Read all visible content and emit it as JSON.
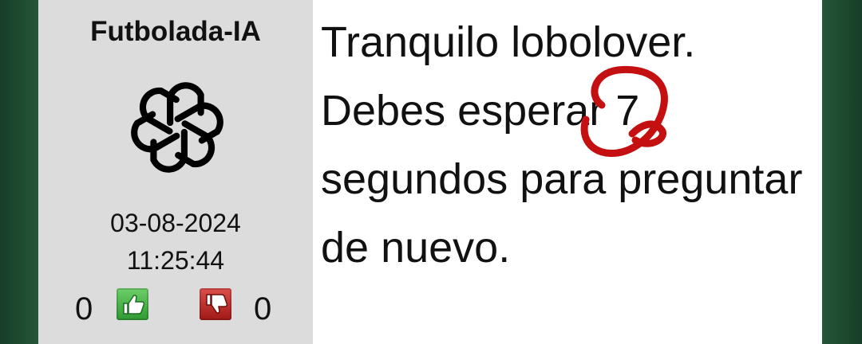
{
  "post": {
    "username": "Futbolada-IA",
    "avatar_icon": "openai-logo-icon",
    "date": "03-08-2024",
    "time": "11:25:44",
    "likes": "0",
    "dislikes": "0",
    "like_icon": "thumbs-up-icon",
    "dislike_icon": "thumbs-down-icon",
    "message": "Tranquilo lobolover. Debes esperar 7 segundos para preguntar de nuevo."
  },
  "colors": {
    "background": "#1e4a2f",
    "user_panel": "#dcdcdc",
    "message_panel": "#ffffff",
    "like_button": "#3aa53c",
    "dislike_button": "#b3201d",
    "annotation_circle": "#c41010"
  }
}
